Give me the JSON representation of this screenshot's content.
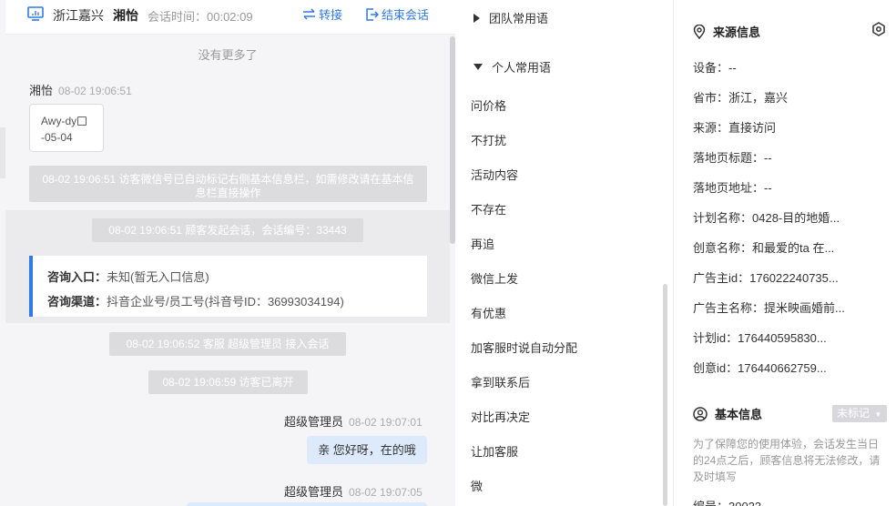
{
  "header": {
    "region": "浙江嘉兴",
    "visitor_name": "湘怡",
    "session_time": "会话时间：00:02:09",
    "transfer_label": "转接",
    "end_label": "结束会话"
  },
  "chat": {
    "no_more": "没有更多了",
    "visitor_meta": {
      "name": "湘怡",
      "time": "08-02 19:06:51"
    },
    "card_lines": [
      "Awy-dy",
      "-05-04"
    ],
    "sys_wechat": "08-02 19:06:51 访客微信号已自动标记右侧基本信息栏，如需修改请在基本信息栏直接操作",
    "sys_session": "08-02 19:06:51 顾客发起会话，会话编号：33443",
    "entry_label": "咨询入口：",
    "entry_value": "未知(暂无入口信息)",
    "channel_label": "咨询渠道：",
    "channel_value": "抖音企业号/员工号(抖音号ID：36993034194)",
    "sys_join": "08-02 19:06:52 客服 超级管理员 接入会话",
    "sys_left": "08-02 19:06:59 访客已离开",
    "agent_meta_1": {
      "name": "超级管理员",
      "time": "08-02 19:07:01"
    },
    "agent_msg_1": "亲 您好呀，在的哦",
    "agent_meta_2": {
      "name": "超级管理员",
      "time": "08-02 19:07:05"
    }
  },
  "phrases": {
    "team_group": "团队常用语",
    "personal_group": "个人常用语",
    "items": [
      "问价格",
      "不打扰",
      "活动内容",
      "不存在",
      "再追",
      "微信上发",
      "有优惠",
      "加客服时说自动分配",
      "拿到联系后",
      "对比再决定",
      "让加客服",
      "微"
    ]
  },
  "source_info": {
    "title": "来源信息",
    "rows": [
      "设备：--",
      "省市：浙江，嘉兴",
      "来源：直接访问",
      "落地页标题：--",
      "落地页地址：--",
      "计划名称：0428-目的地婚...",
      "创意名称：和最爱的ta 在...",
      "广告主id：176022240735...",
      "广告主名称：提米映画婚前...",
      "计划id：176440595830...",
      "创意id：176440662759..."
    ]
  },
  "basic_info": {
    "title": "基本信息",
    "badge": "未标记",
    "note": "为了保障您的使用体验，会话发生当日的24点之后，顾客信息将无法修改，请及时填写",
    "partial_row": "编号：30033"
  },
  "colors": {
    "accent": "#2f7ae5",
    "sys_bg": "#dcdcdf",
    "bubble_bg": "#dceafb"
  }
}
